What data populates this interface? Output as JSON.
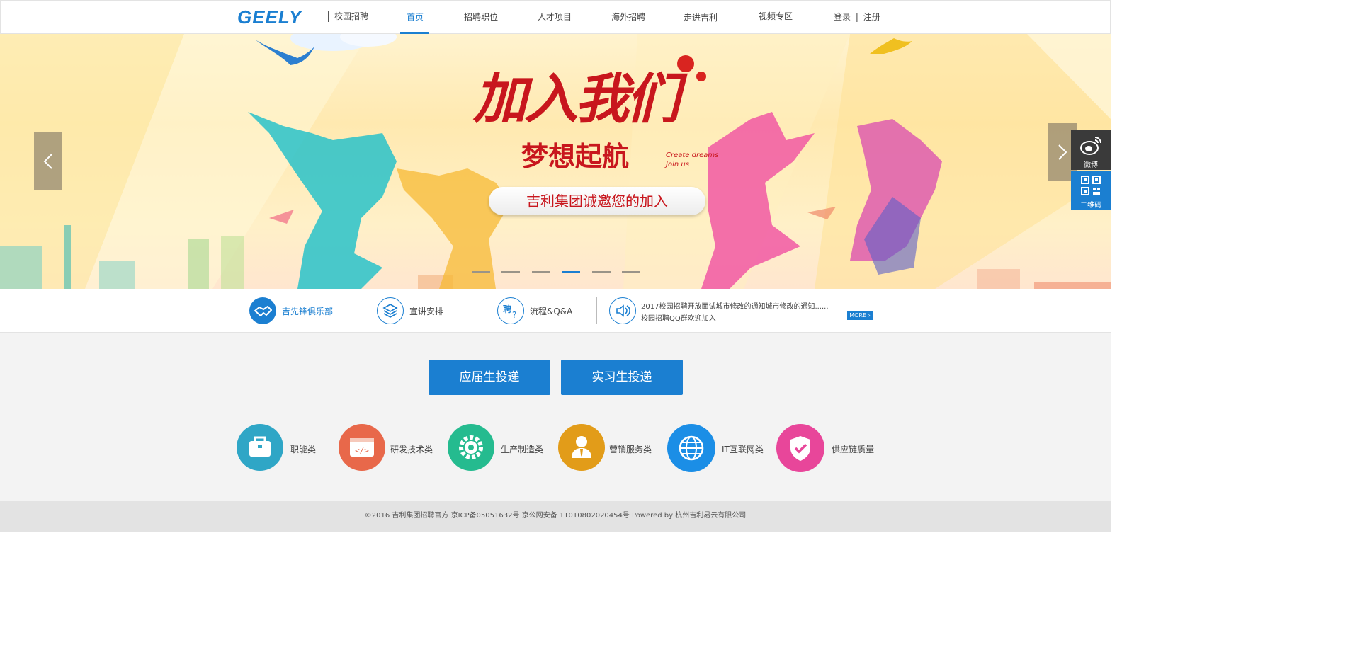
{
  "header": {
    "logo_text": "GEELY",
    "logo_sub": "校园招聘",
    "nav": [
      {
        "label": "首页",
        "active": true
      },
      {
        "label": "招聘职位"
      },
      {
        "label": "人才项目"
      },
      {
        "label": "海外招聘"
      },
      {
        "label": "走进吉利"
      },
      {
        "label": "视频专区"
      }
    ],
    "login": "登录",
    "register": "注册",
    "auth_sep": "|"
  },
  "banner": {
    "headline": "加入我们",
    "subline": "梦想起航",
    "english_1": "Create dreams",
    "english_2": "Join us",
    "slogan": "吉利集团诚邀您的加入",
    "slide_count": 6,
    "active_slide": 4
  },
  "side": {
    "weibo_label": "微博",
    "qr_label": "二维码"
  },
  "quickbar": {
    "items": [
      {
        "label": "吉先锋俱乐部",
        "icon": "handshake-icon"
      },
      {
        "label": "宣讲安排",
        "icon": "layers-icon"
      },
      {
        "label": "流程&Q&A",
        "icon": "hire-question-icon"
      }
    ],
    "notices": [
      "2017校园招聘开放面试城市修改的通知城市修改的通知......",
      "校园招聘QQ群欢迎加入"
    ],
    "more_label": "MORE"
  },
  "main": {
    "buttons": {
      "graduate": "应届生投递",
      "intern": "实习生投递"
    },
    "categories": [
      {
        "label": "职能类",
        "icon": "briefcase-icon",
        "color": "#2fa6c6"
      },
      {
        "label": "研发技术类",
        "icon": "code-window-icon",
        "color": "#e8684a"
      },
      {
        "label": "生产制造类",
        "icon": "gear-icon",
        "color": "#25bb8f"
      },
      {
        "label": "营销服务类",
        "icon": "person-tie-icon",
        "color": "#e29c19"
      },
      {
        "label": "IT互联网类",
        "icon": "globe-icon",
        "color": "#1b8ee6"
      },
      {
        "label": "供应链质量",
        "icon": "shield-check-icon",
        "color": "#e8469a"
      }
    ]
  },
  "footer": {
    "text": "©2016  吉利集团招聘官方   京ICP备05051632号 京公网安备 11010802020454号 Powered by 杭州吉利易云有限公司"
  },
  "colors": {
    "brand_blue": "#1b7fd1",
    "headline_red": "#c8161d"
  }
}
